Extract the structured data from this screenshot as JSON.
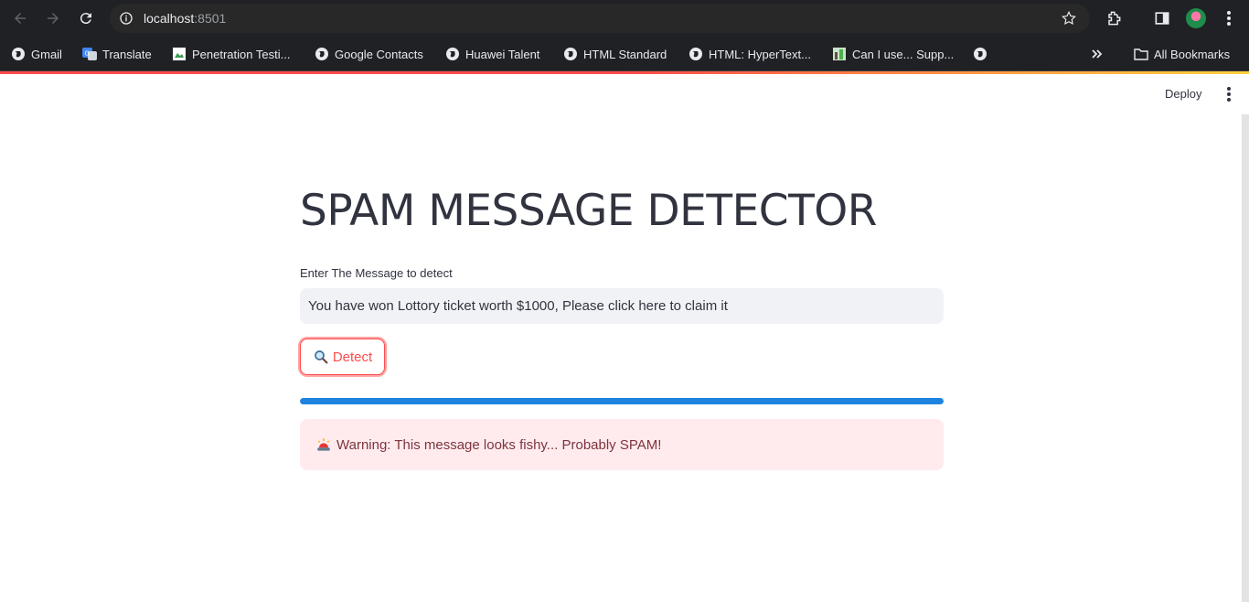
{
  "browser": {
    "url_host": "localhost",
    "url_port": ":8501",
    "bookmarks": [
      {
        "label": "Gmail",
        "icon": "globe-icon"
      },
      {
        "label": "Translate",
        "icon": "translate-icon"
      },
      {
        "label": "Penetration Testi...",
        "icon": "page-icon"
      },
      {
        "label": "Google Contacts",
        "icon": "globe-icon"
      },
      {
        "label": "Huawei Talent",
        "icon": "globe-icon"
      },
      {
        "label": "HTML Standard",
        "icon": "globe-icon"
      },
      {
        "label": "HTML: HyperText...",
        "icon": "globe-icon"
      },
      {
        "label": "Can I use... Supp...",
        "icon": "image-icon"
      }
    ],
    "all_bookmarks_label": "All Bookmarks"
  },
  "app": {
    "deploy_label": "Deploy",
    "title": "SPAM MESSAGE DETECTOR",
    "input_label": "Enter The Message to detect",
    "input_value": "You have won Lottory ticket worth $1000, Please click here to claim it",
    "detect_label": "Detect",
    "progress_percent": 100,
    "alert_text": "Warning: This message looks fishy... Probably SPAM!",
    "colors": {
      "primary": "#ff4b4b",
      "progress": "#1c83e1",
      "alert_bg": "#ffebee",
      "alert_text": "#7d353b"
    }
  }
}
